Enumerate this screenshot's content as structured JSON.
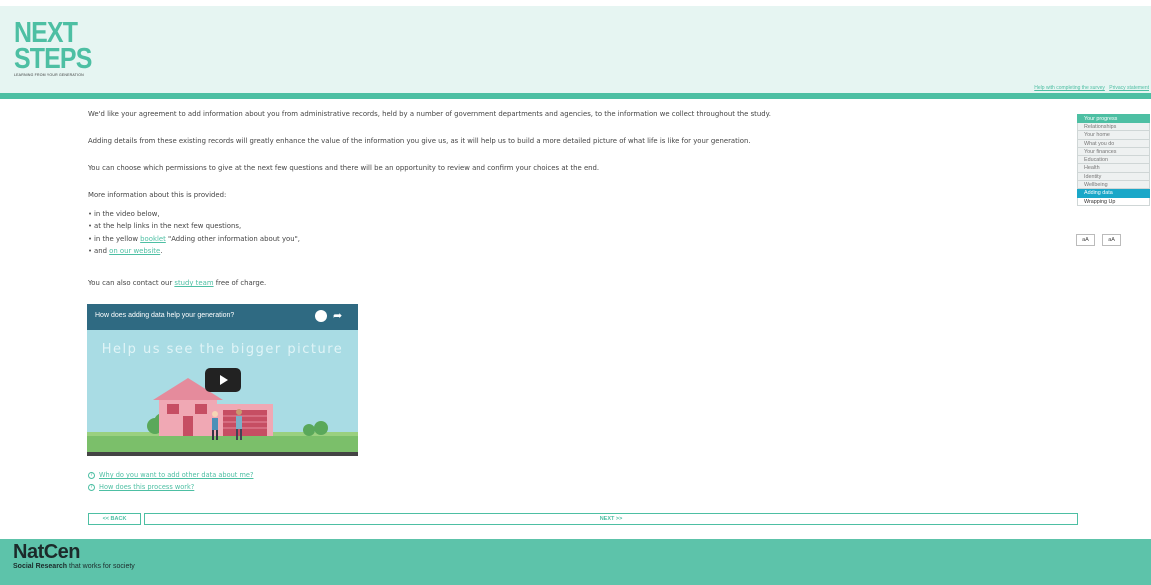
{
  "header": {
    "logo_line1": "NEXT",
    "logo_line2": "STEPS",
    "logo_tagline": "LEARNING FROM YOUR GENERATION",
    "links": [
      "Help with completing the survey",
      "Privacy statement"
    ]
  },
  "content": {
    "para1": "We'd like your agreement to add information about you from administrative records, held by a number of government departments and agencies, to the information we collect throughout the study.",
    "para2": "Adding details from these existing records will greatly enhance the value of the information you give us, as it will help us to build a more detailed picture of what life is like for your generation.",
    "para3": "You can choose which permissions to give at the next few questions and there will be an opportunity to review and confirm your choices at the end.",
    "para4": "More information about this is provided:",
    "bullets": {
      "b1": "in the video below,",
      "b2": "at the help links in the next few questions,",
      "b3_pre": "in the yellow ",
      "b3_link": "booklet",
      "b3_post": " \"Adding other information about you\",",
      "b4_pre": "and ",
      "b4_link": "on our website",
      "b4_post": "."
    },
    "contact_pre": "You can also contact our ",
    "contact_link": "study team",
    "contact_post": " free of charge."
  },
  "video": {
    "title": "How does adding data help your generation?",
    "caption": "Help us see the bigger picture"
  },
  "help_links": {
    "q1": "Why do you want to add other data about me?",
    "q2": "How does this process work?"
  },
  "nav": {
    "back": "<< BACK",
    "next": "NEXT >>"
  },
  "progress": {
    "header": "Your progress",
    "items": [
      "Relationships",
      "Your home",
      "What you do",
      "Your finances",
      "Education",
      "Health",
      "Identity",
      "Wellbeing"
    ],
    "current": "Adding data",
    "next": "Wrapping Up"
  },
  "font_controls": {
    "smaller": "aA",
    "larger": "aA"
  },
  "footer": {
    "logo": "NatCen",
    "tagline_bold": "Social Research",
    "tagline_rest": " that works for society"
  },
  "colors": {
    "brand": "#4dbfa3",
    "current_step": "#1aa7c8",
    "header_bg": "#e6f5f2",
    "footer_bg": "#5dc3aa"
  }
}
